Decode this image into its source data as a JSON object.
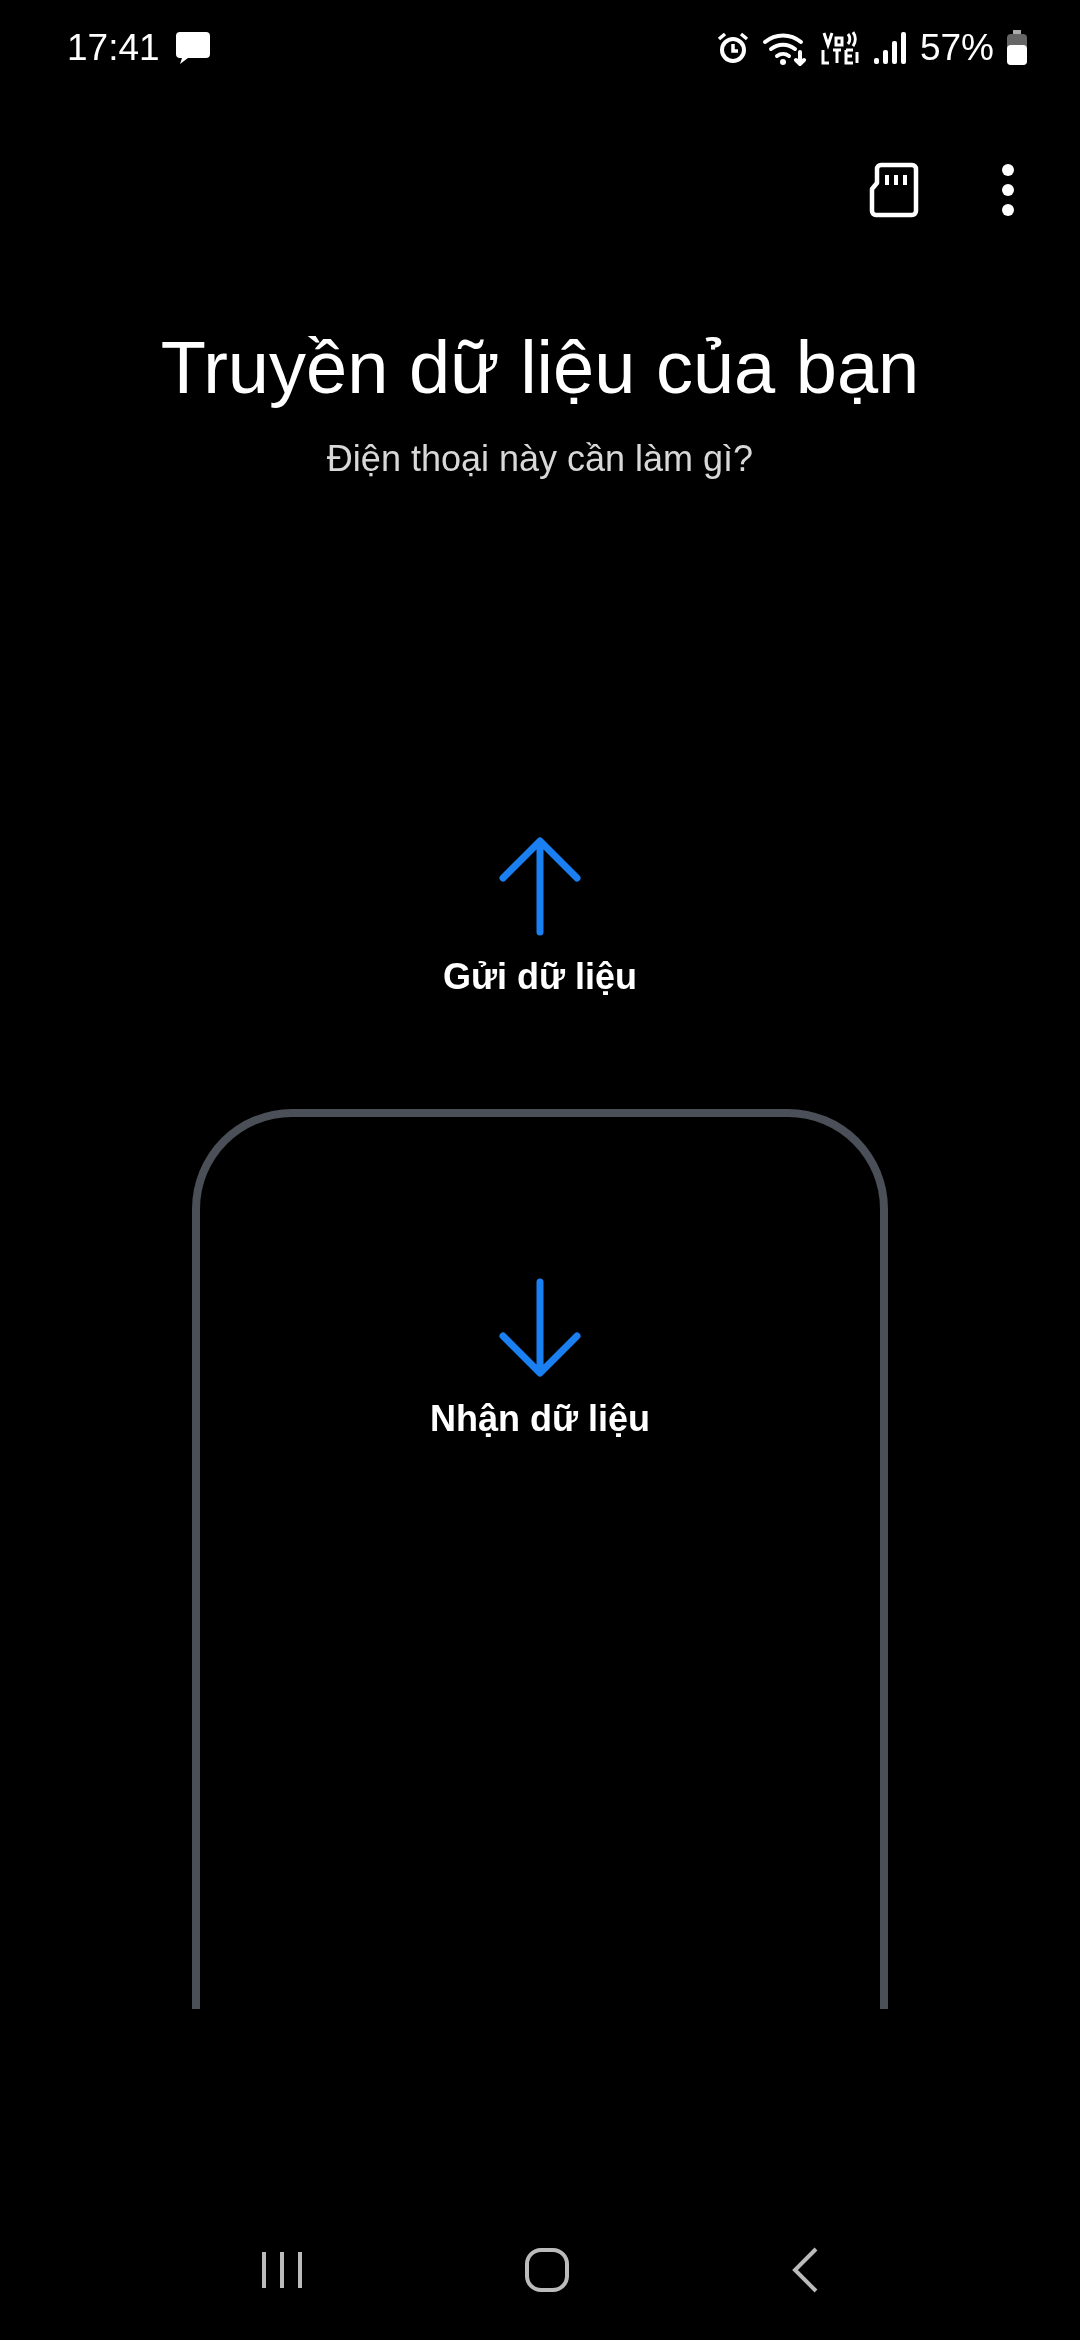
{
  "status_bar": {
    "time": "17:41",
    "battery": "57%"
  },
  "title": "Truyền dữ liệu của bạn",
  "subtitle": "Điện thoại này cần làm gì?",
  "options": [
    {
      "kind": "send",
      "label": "Gửi dữ liệu"
    },
    {
      "kind": "receive",
      "label": "Nhận dữ liệu"
    }
  ]
}
